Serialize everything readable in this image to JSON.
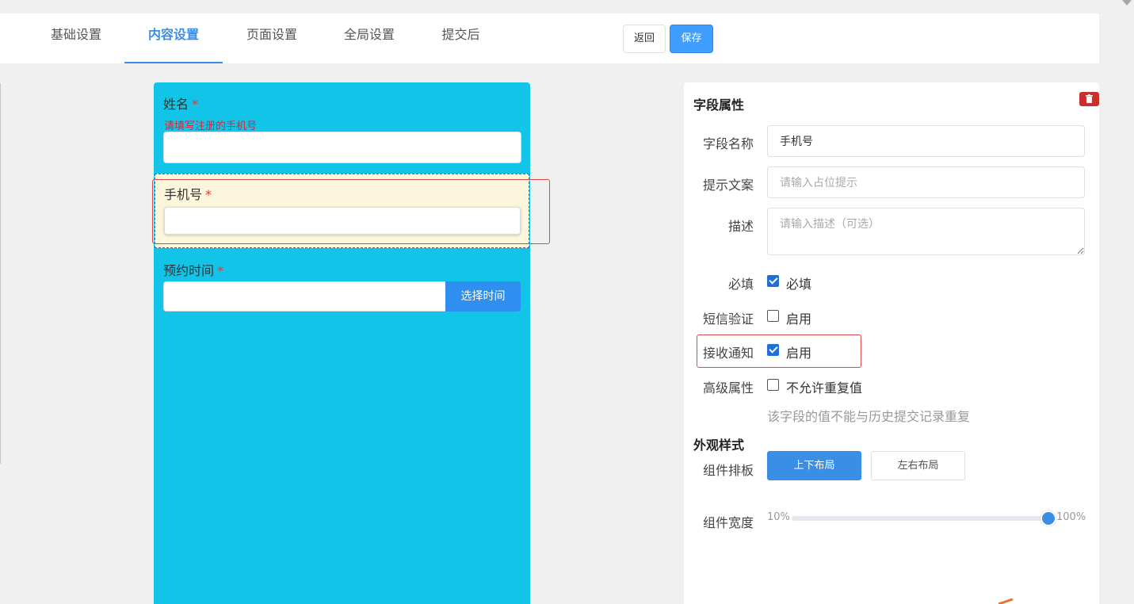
{
  "nav": {
    "tabs": [
      {
        "label": "基础设置"
      },
      {
        "label": "内容设置",
        "active": true
      },
      {
        "label": "页面设置"
      },
      {
        "label": "全局设置"
      },
      {
        "label": "提交后"
      }
    ],
    "back_label": "返回",
    "save_label": "保存"
  },
  "preview": {
    "background_color": "#12c4e8",
    "fields": [
      {
        "label": "姓名",
        "required_mark": "*",
        "hint": "请填写注册的手机号",
        "value": ""
      },
      {
        "label": "手机号",
        "required_mark": "*",
        "value": "",
        "selected": true
      },
      {
        "label": "预约时间",
        "required_mark": "*",
        "value": "",
        "button_label": "选择时间"
      }
    ]
  },
  "properties": {
    "title": "字段属性",
    "delete_icon": "trash-icon",
    "name": {
      "label": "字段名称",
      "value": "手机号"
    },
    "placeholder_field": {
      "label": "提示文案",
      "placeholder": "请输入占位提示",
      "value": ""
    },
    "description": {
      "label": "描述",
      "placeholder": "请输入描述（可选）",
      "value": ""
    },
    "required": {
      "label": "必填",
      "option_label": "必填",
      "checked": true
    },
    "sms_verify": {
      "label": "短信验证",
      "option_label": "启用",
      "checked": false
    },
    "notify": {
      "label": "接收通知",
      "option_label": "启用",
      "checked": true
    },
    "advanced": {
      "label": "高级属性",
      "option_label": "不允许重复值",
      "checked": false,
      "note": "该字段的值不能与历史提交记录重复"
    }
  },
  "appearance": {
    "title": "外观样式",
    "layout_label": "组件排板",
    "layout_options": [
      "上下布局",
      "左右布局"
    ],
    "layout_selected": "上下布局",
    "width_label": "组件宽度",
    "width_min": "10%",
    "width_max": "100%",
    "width_value_percent": 100
  },
  "colors": {
    "accent": "#3a8ee6",
    "required": "#e33333",
    "highlight_box": "#e04848"
  }
}
